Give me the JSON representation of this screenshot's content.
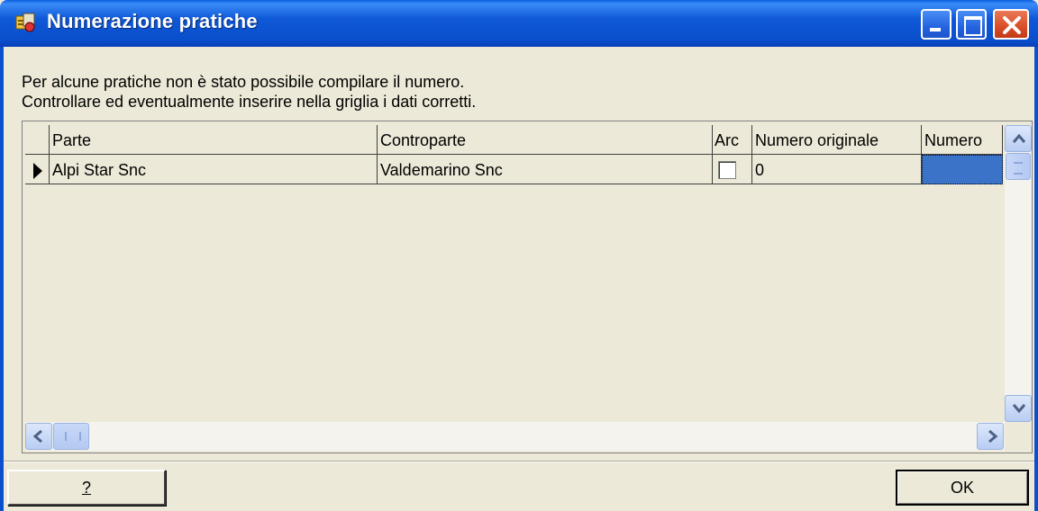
{
  "window": {
    "title": "Numerazione pratiche"
  },
  "message": {
    "line1": "Per alcune pratiche non è stato possibile compilare il numero.",
    "line2": "Controllare ed eventualmente inserire nella griglia i dati corretti."
  },
  "grid": {
    "columns": [
      "Parte",
      "Controparte",
      "Arc",
      "Numero originale",
      "Numero"
    ],
    "rows": [
      {
        "parte": "Alpi Star Snc",
        "controparte": "Valdemarino Snc",
        "arc_checked": false,
        "numero_originale": "0",
        "numero": ""
      }
    ]
  },
  "buttons": {
    "help": "?",
    "ok": "OK"
  },
  "colors": {
    "titlebar": "#0a4fcc",
    "face": "#ece9d8",
    "selection": "#3b73c8"
  }
}
